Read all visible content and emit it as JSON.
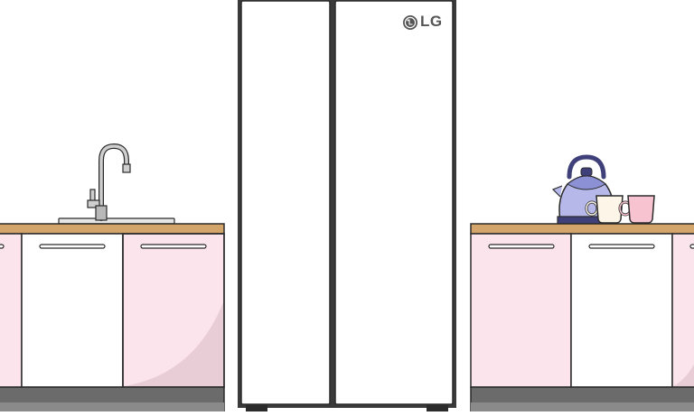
{
  "brand": {
    "logo_text": "LG",
    "logo_color": "#555555"
  },
  "colors": {
    "background": "#ffffff",
    "outline": "#2b2b2b",
    "countertop": "#d4a56a",
    "cabinet_pink": "#fce4ec",
    "cabinet_pink_shadow": "#e9cdd6",
    "cabinet_white": "#ffffff",
    "plinth": "#6b6b6b",
    "fridge": "#ffffff",
    "kettle": "#b5b8e8",
    "kettle_dark": "#3f3f7a",
    "mug_cream": "#fdf6e8",
    "mug_pink": "#f8c3d0",
    "faucet": "#cfcfcf"
  },
  "icons": [
    "faucet-icon",
    "kettle-icon",
    "mug-icon",
    "lg-logo-icon"
  ]
}
